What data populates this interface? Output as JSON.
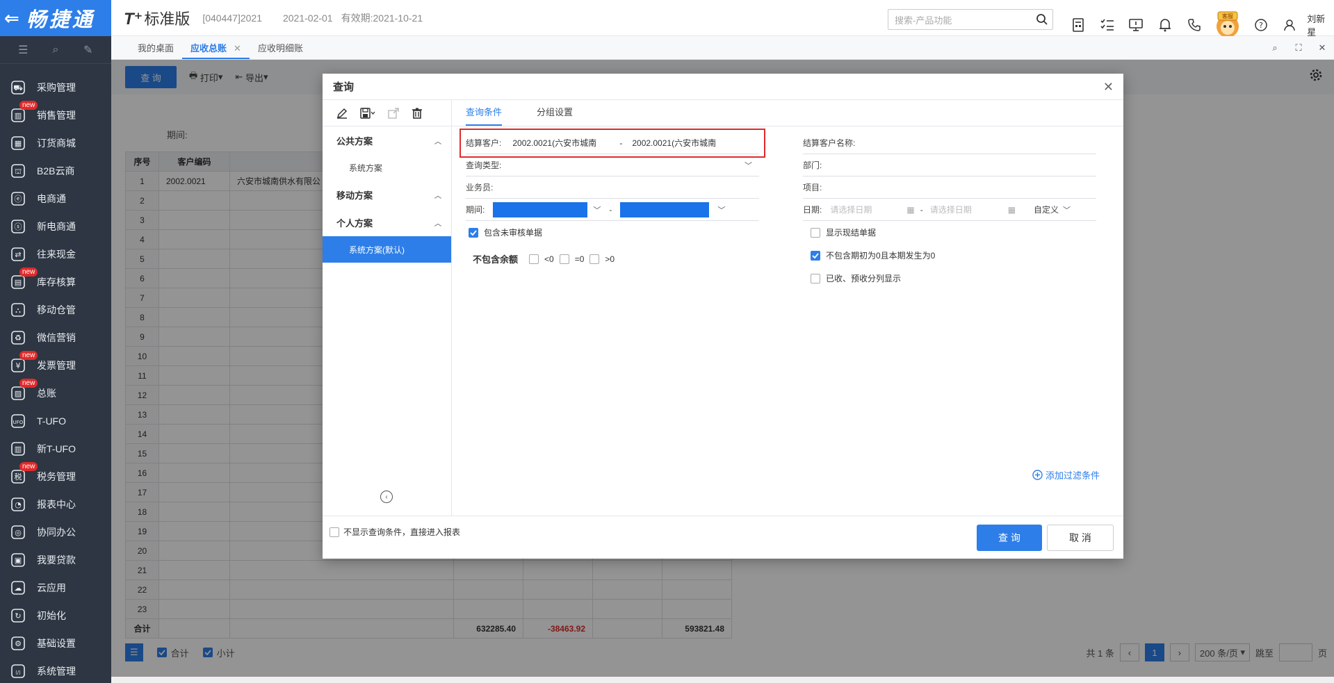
{
  "app": {
    "logo": "畅捷通",
    "brand": "T⁺",
    "edition": "标准版",
    "account": "[040447]2021",
    "login_date": "2021-02-01",
    "validity": "有效期:2021-10-21",
    "search_placeholder": "搜索-产品功能",
    "user": "刘新星",
    "service_badge": "客服"
  },
  "sidebar": {
    "items": [
      {
        "label": "采购管理",
        "icon": "purchase-icon",
        "new": false
      },
      {
        "label": "销售管理",
        "icon": "sales-icon",
        "new": true
      },
      {
        "label": "订货商城",
        "icon": "mall-icon",
        "new": false
      },
      {
        "label": "B2B云商",
        "icon": "b2b-icon",
        "new": false
      },
      {
        "label": "电商通",
        "icon": "ecommerce-icon",
        "new": false
      },
      {
        "label": "新电商通",
        "icon": "new-ecommerce-icon",
        "new": false
      },
      {
        "label": "往来现金",
        "icon": "cash-icon",
        "new": false
      },
      {
        "label": "库存核算",
        "icon": "inventory-icon",
        "new": true
      },
      {
        "label": "移动仓管",
        "icon": "mobile-warehouse-icon",
        "new": false
      },
      {
        "label": "微信营销",
        "icon": "wechat-icon",
        "new": false
      },
      {
        "label": "发票管理",
        "icon": "invoice-icon",
        "new": true
      },
      {
        "label": "总账",
        "icon": "ledger-icon",
        "new": true
      },
      {
        "label": "T-UFO",
        "icon": "ufo-icon",
        "new": false
      },
      {
        "label": "新T-UFO",
        "icon": "new-ufo-icon",
        "new": false
      },
      {
        "label": "税务管理",
        "icon": "tax-icon",
        "new": true
      },
      {
        "label": "报表中心",
        "icon": "report-icon",
        "new": false
      },
      {
        "label": "协同办公",
        "icon": "office-icon",
        "new": false
      },
      {
        "label": "我要贷款",
        "icon": "loan-icon",
        "new": false
      },
      {
        "label": "云应用",
        "icon": "cloud-icon",
        "new": false
      },
      {
        "label": "初始化",
        "icon": "init-icon",
        "new": false
      },
      {
        "label": "基础设置",
        "icon": "settings-icon",
        "new": false
      },
      {
        "label": "系统管理",
        "icon": "system-icon",
        "new": false
      }
    ],
    "new_label": "new"
  },
  "tabs": [
    {
      "label": "我的桌面",
      "active": false
    },
    {
      "label": "应收总账",
      "active": true
    },
    {
      "label": "应收明细账",
      "active": false
    }
  ],
  "toolbar": {
    "query": "查 询",
    "print": "打印",
    "export": "导出"
  },
  "report": {
    "period_label": "期间:",
    "columns": [
      "序号",
      "客户编码"
    ],
    "first_row": {
      "code": "2002.0021",
      "name": "六安市城南供水有限公"
    },
    "row_count": 23,
    "total_label": "合计",
    "totals": [
      "632285.40",
      "-38463.92",
      "593821.48"
    ]
  },
  "pager": {
    "sum_label": "合计",
    "subtotal_label": "小计",
    "total_count": "共 1 条",
    "current_page": "1",
    "page_size": "200 条/页",
    "jump": "跳至",
    "page_unit": "页"
  },
  "modal": {
    "title": "查询",
    "schemes": {
      "public": "公共方案",
      "public_items": [
        "系统方案"
      ],
      "mobile": "移动方案",
      "personal": "个人方案",
      "personal_items": [
        "系统方案(默认)"
      ]
    },
    "tabs": [
      "查询条件",
      "分组设置"
    ],
    "left_fields": {
      "customer_label": "结算客户:",
      "customer_from": "2002.0021(六安市城南",
      "customer_to": "2002.0021(六安市城南",
      "range_sep": "-",
      "query_type": "查询类型:",
      "salesperson": "业务员:",
      "period": "期间:",
      "include_unaudited": "包含未审核单据",
      "exclude_balance": "不包含余额",
      "lt0": "<0",
      "eq0": "=0",
      "gt0": ">0"
    },
    "right_fields": {
      "customer_name": "结算客户名称:",
      "department": "部门:",
      "project": "项目:",
      "date": "日期:",
      "date_placeholder": "请选择日期",
      "custom": "自定义",
      "show_cash": "显示现结单据",
      "exclude_zero": "不包含期初为0且本期发生为0",
      "separate": "已收、预收分列显示"
    },
    "add_filter": "添加过滤条件",
    "skip_label": "不显示查询条件，直接进入报表",
    "ok": "查 询",
    "cancel": "取 消"
  },
  "colors": {
    "primary": "#2d7ee8",
    "sidebar": "#2d3642",
    "highlight": "#e02a2a"
  }
}
